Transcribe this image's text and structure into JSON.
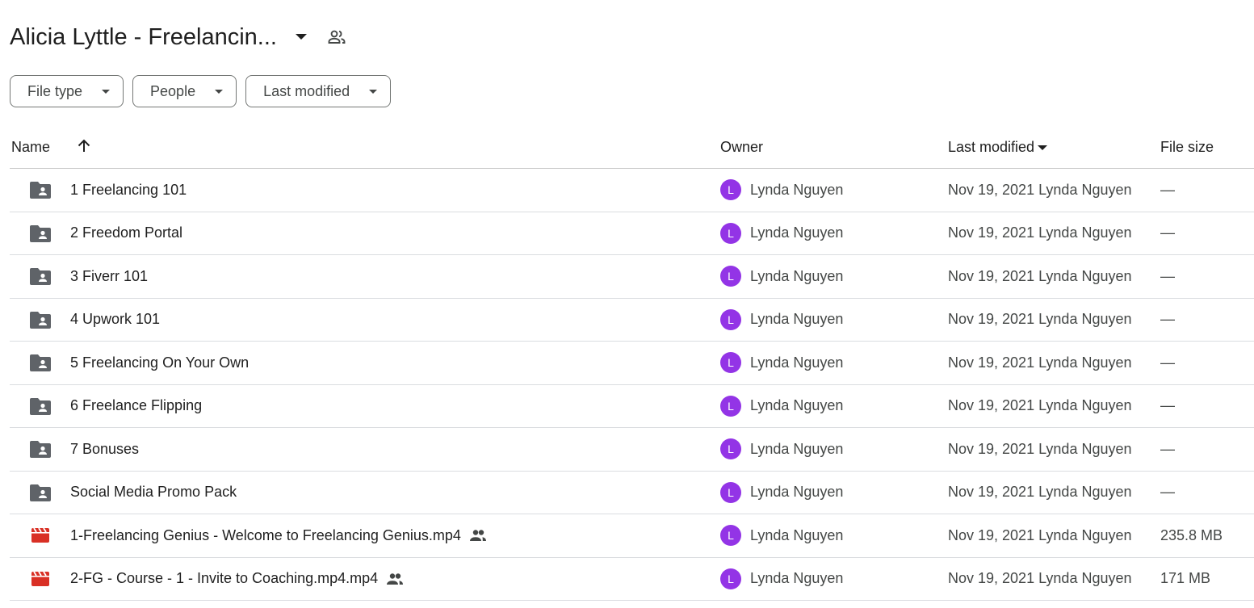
{
  "header": {
    "title": "Alicia Lyttle - Freelancin...",
    "caret_icon": "arrow-drop-down-icon",
    "shared_icon": "people-icon"
  },
  "filters": [
    {
      "label": "File type",
      "icon": "arrow-drop-down-icon"
    },
    {
      "label": "People",
      "icon": "arrow-drop-down-icon"
    },
    {
      "label": "Last modified",
      "icon": "arrow-drop-down-icon"
    }
  ],
  "table": {
    "columns": {
      "name": "Name",
      "owner": "Owner",
      "last_modified": "Last modified",
      "file_size": "File size"
    },
    "rows": [
      {
        "type": "shared-folder",
        "name": "1 Freelancing 101",
        "shared": false,
        "owner_initial": "L",
        "owner": "Lynda Nguyen",
        "modified": "Nov 19, 2021 Lynda Nguyen",
        "size": "—"
      },
      {
        "type": "shared-folder",
        "name": "2 Freedom Portal",
        "shared": false,
        "owner_initial": "L",
        "owner": "Lynda Nguyen",
        "modified": "Nov 19, 2021 Lynda Nguyen",
        "size": "—"
      },
      {
        "type": "shared-folder",
        "name": "3 Fiverr 101",
        "shared": false,
        "owner_initial": "L",
        "owner": "Lynda Nguyen",
        "modified": "Nov 19, 2021 Lynda Nguyen",
        "size": "—"
      },
      {
        "type": "shared-folder",
        "name": "4 Upwork 101",
        "shared": false,
        "owner_initial": "L",
        "owner": "Lynda Nguyen",
        "modified": "Nov 19, 2021 Lynda Nguyen",
        "size": "—"
      },
      {
        "type": "shared-folder",
        "name": "5 Freelancing On Your Own",
        "shared": false,
        "owner_initial": "L",
        "owner": "Lynda Nguyen",
        "modified": "Nov 19, 2021 Lynda Nguyen",
        "size": "—"
      },
      {
        "type": "shared-folder",
        "name": "6 Freelance Flipping",
        "shared": false,
        "owner_initial": "L",
        "owner": "Lynda Nguyen",
        "modified": "Nov 19, 2021 Lynda Nguyen",
        "size": "—"
      },
      {
        "type": "shared-folder",
        "name": "7 Bonuses",
        "shared": false,
        "owner_initial": "L",
        "owner": "Lynda Nguyen",
        "modified": "Nov 19, 2021 Lynda Nguyen",
        "size": "—"
      },
      {
        "type": "shared-folder",
        "name": "Social Media Promo Pack",
        "shared": false,
        "owner_initial": "L",
        "owner": "Lynda Nguyen",
        "modified": "Nov 19, 2021 Lynda Nguyen",
        "size": "—"
      },
      {
        "type": "video",
        "name": "1-Freelancing Genius - Welcome to Freelancing Genius.mp4",
        "shared": true,
        "owner_initial": "L",
        "owner": "Lynda Nguyen",
        "modified": "Nov 19, 2021 Lynda Nguyen",
        "size": "235.8 MB"
      },
      {
        "type": "video",
        "name": "2-FG - Course - 1 - Invite to Coaching.mp4.mp4",
        "shared": true,
        "owner_initial": "L",
        "owner": "Lynda Nguyen",
        "modified": "Nov 19, 2021 Lynda Nguyen",
        "size": "171 MB"
      }
    ]
  },
  "colors": {
    "avatar_bg": "#9334e6",
    "video_icon": "#d93025",
    "folder_icon": "#5f6368",
    "text_primary": "#1f1f1f",
    "text_secondary": "#444746"
  }
}
